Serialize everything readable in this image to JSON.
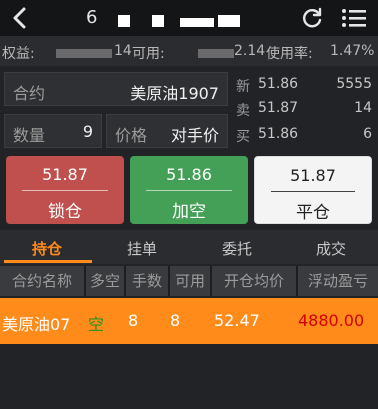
{
  "header": {
    "title_visible": "6"
  },
  "account": {
    "equity_label": "权益:",
    "equity_tail": "14",
    "available_label": "可用:",
    "available_tail": "2.14",
    "usage_label": "使用率:",
    "usage_value": "1.47%"
  },
  "form": {
    "contract_label": "合约",
    "contract_value": "美原油1907",
    "qty_label": "数量",
    "qty_value": "9",
    "price_label": "价格",
    "price_value": "对手价"
  },
  "quote": {
    "last": {
      "label": "新",
      "price": "51.86",
      "volume": "5555"
    },
    "ask": {
      "label": "卖",
      "price": "51.87",
      "volume": "14"
    },
    "bid": {
      "label": "买",
      "price": "51.86",
      "volume": "6"
    }
  },
  "buttons": {
    "lock": {
      "price": "51.87",
      "label": "锁仓"
    },
    "short": {
      "price": "51.86",
      "label": "加空"
    },
    "close": {
      "price": "51.87",
      "label": "平仓"
    }
  },
  "tabs": [
    "持仓",
    "挂单",
    "委托",
    "成交"
  ],
  "active_tab": "持仓",
  "table": {
    "headers": [
      "合约名称",
      "多空",
      "手数",
      "可用",
      "开仓均价",
      "浮动盈亏"
    ],
    "rows": [
      [
        "美原油07",
        "空",
        "8",
        "8",
        "52.47",
        "4880.00"
      ]
    ]
  },
  "colors": {
    "accent": "#ff8a1c",
    "lock_button": "#c0504e",
    "short_button": "#44a056",
    "loss": "#d40000"
  }
}
